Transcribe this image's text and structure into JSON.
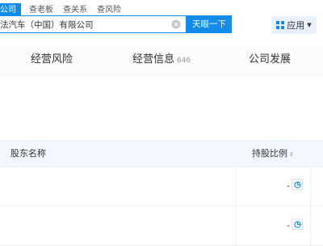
{
  "search_tabs": [
    "公司",
    "查老板",
    "查关系",
    "查风险"
  ],
  "search": {
    "value": "法汽车（中国）有限公司",
    "button_label": "天眼一下"
  },
  "apps_button": {
    "label": "应用"
  },
  "nav": [
    {
      "label": "经营风险",
      "count": ""
    },
    {
      "label": "经营信息",
      "count": "646"
    },
    {
      "label": "公司发展",
      "count": ""
    }
  ],
  "table": {
    "headers": {
      "name": "股东名称",
      "ratio": "持股比例"
    },
    "rows": [
      {
        "name": "",
        "ratio": "-"
      },
      {
        "name": "",
        "ratio": "-"
      }
    ]
  },
  "colors": {
    "accent": "#128bed",
    "nav_bg": "#fafbfc",
    "header_bg": "#f2f8fe"
  }
}
